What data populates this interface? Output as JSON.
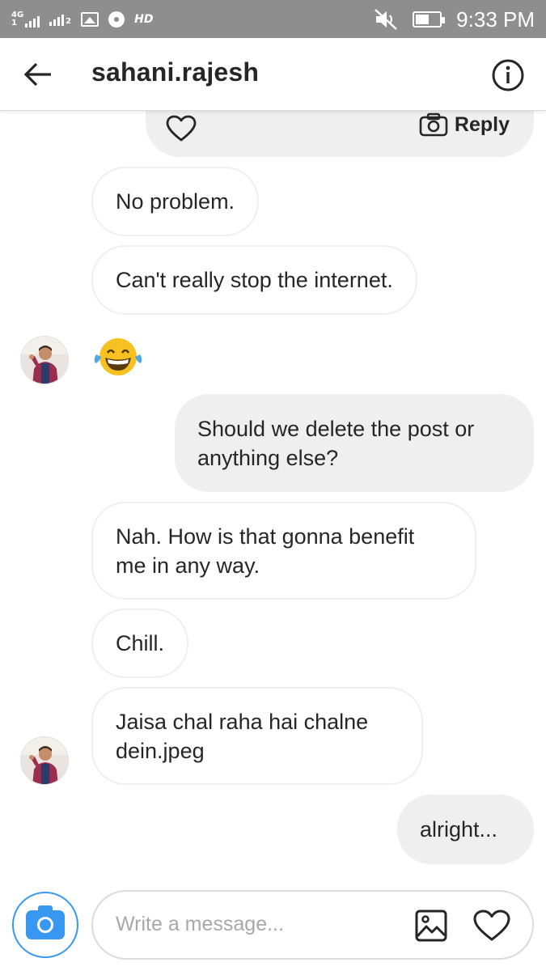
{
  "status_bar": {
    "network_type": "4G",
    "network_sub": "1",
    "sim2": "2",
    "hd": "HD",
    "time": "9:33 PM",
    "battery_level": 0.55
  },
  "header": {
    "title": "sahani.rajesh",
    "back_icon": "arrow-left-icon",
    "info_icon": "info-circle-icon"
  },
  "shared_post": {
    "reply_label": "Reply",
    "heart_icon": "heart-outline-icon",
    "camera_icon": "camera-outline-icon"
  },
  "messages": [
    {
      "from": "them",
      "text": "No problem."
    },
    {
      "from": "them",
      "text": "Can't really stop the internet."
    },
    {
      "from": "them",
      "type": "emoji",
      "emoji": "face-with-tears-of-joy-emoji"
    },
    {
      "from": "me",
      "text_line1": "Should we delete the post or",
      "text_line2": "anything else?"
    },
    {
      "from": "them",
      "text_line1": "Nah. How is that gonna benefit",
      "text_line2": "me in any way."
    },
    {
      "from": "them",
      "text": "Chill."
    },
    {
      "from": "them",
      "text_line1": "Jaisa chal raha hai chalne",
      "text_line2": "dein.jpeg"
    },
    {
      "from": "me",
      "text": "alright..."
    }
  ],
  "composer": {
    "placeholder": "Write a message...",
    "camera_icon": "camera-icon",
    "gallery_icon": "image-icon",
    "like_icon": "heart-outline-icon",
    "accent": "#3897f0"
  },
  "colors": {
    "status_bar": "#8e8e8e",
    "bubble_outgoing": "#efefef",
    "bubble_incoming_border": "#efefef",
    "text": "#262626"
  }
}
